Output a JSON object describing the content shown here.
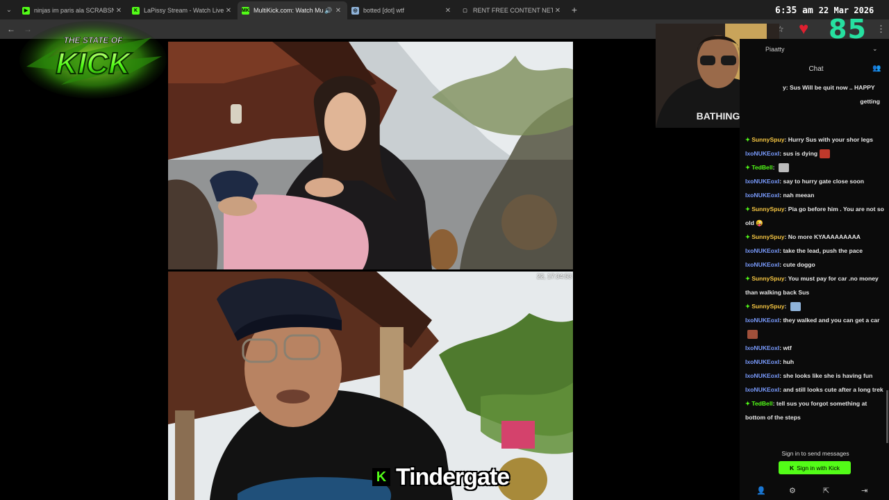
{
  "browser": {
    "tabs": [
      {
        "title": "ninjas im paris ala SCRABSNYC",
        "favicon": "play-icon",
        "active": false
      },
      {
        "title": "LaPissy Stream - Watch Live on",
        "favicon": "kick-icon",
        "active": false
      },
      {
        "title": "MultiKick.com: Watch Multi",
        "favicon": "multikick-icon",
        "active": true
      },
      {
        "title": "botted [dot] wtf",
        "favicon": "bot-icon",
        "active": false
      },
      {
        "title": "RENT FREE CONTENT NETWOR",
        "favicon": "page-icon",
        "active": false
      }
    ],
    "new_tab": "+"
  },
  "overlay": {
    "time": "6:35 am",
    "date": "22 Mar 2026",
    "counter": "85",
    "logo_text_top": "THE STATE OF",
    "logo_text_main": "KICK",
    "caption": "Tindergate",
    "caption_badge": "K",
    "timestamp": "22, 17:34:53"
  },
  "chat": {
    "streamer": "Piaatty",
    "title": "Chat",
    "partial_lines": [
      {
        "text": "y:  Sus Will be quit now .. HAPPY"
      },
      {
        "text": "getting"
      }
    ],
    "messages": [
      {
        "user": "SunnySpuy",
        "badge": true,
        "color": "#f5c542",
        "text": "Hurry Sus with your shor legs"
      },
      {
        "user": "IxoNUKEoxI",
        "badge": false,
        "color": "#7a9cff",
        "text": "sus is dying",
        "emote": "#c0392b"
      },
      {
        "user": "TedBell",
        "badge": true,
        "color": "#53fc18",
        "text": "",
        "emote": "#bbbbbb"
      },
      {
        "user": "IxoNUKEoxI",
        "badge": false,
        "color": "#7a9cff",
        "text": "say to hurry gate close soon"
      },
      {
        "user": "IxoNUKEoxI",
        "badge": false,
        "color": "#7a9cff",
        "text": "nah meean"
      },
      {
        "user": "SunnySpuy",
        "badge": true,
        "color": "#f5c542",
        "text": "Pia go before him . You are not so old 😜"
      },
      {
        "user": "SunnySpuy",
        "badge": true,
        "color": "#f5c542",
        "text": "No more KYAAAAAAAAA"
      },
      {
        "user": "IxoNUKEoxI",
        "badge": false,
        "color": "#7a9cff",
        "text": "take the lead, push the pace"
      },
      {
        "user": "IxoNUKEoxI",
        "badge": false,
        "color": "#7a9cff",
        "text": "cute doggo"
      },
      {
        "user": "SunnySpuy",
        "badge": true,
        "color": "#f5c542",
        "text": "You must pay for car .no money than walking back Sus"
      },
      {
        "user": "SunnySpuy",
        "badge": true,
        "color": "#f5c542",
        "text": "",
        "emote": "#8fb3d9"
      },
      {
        "user": "IxoNUKEoxI",
        "badge": false,
        "color": "#7a9cff",
        "text": "they walked and you can get a car",
        "emote": "#a0503a"
      },
      {
        "user": "IxoNUKEoxI",
        "badge": false,
        "color": "#7a9cff",
        "text": "wtf"
      },
      {
        "user": "IxoNUKEoxI",
        "badge": false,
        "color": "#7a9cff",
        "text": "huh"
      },
      {
        "user": "IxoNUKEoxI",
        "badge": false,
        "color": "#7a9cff",
        "text": "she looks like she is having fun"
      },
      {
        "user": "IxoNUKEoxI",
        "badge": false,
        "color": "#7a9cff",
        "text": "and still looks cute after a long trek"
      },
      {
        "user": "TedBell",
        "badge": true,
        "color": "#53fc18",
        "text": "tell sus you forgot something at bottom of the steps"
      }
    ],
    "signin_note": "Sign in to send messages",
    "signin_button": "Sign in with Kick",
    "signin_k": "K"
  },
  "colors": {
    "kick_green": "#53fc18",
    "counter": "#26e0a0",
    "heart": "#e02030"
  }
}
